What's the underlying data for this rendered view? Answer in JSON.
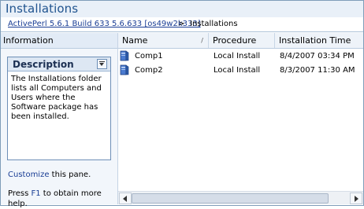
{
  "window": {
    "title": "Installations"
  },
  "breadcrumb": {
    "link": "ActivePerl 5.6.1 Build 633 5.6.633 [os49w2k333]",
    "separator": ">",
    "current": "Installations"
  },
  "left_pane": {
    "header": "Information",
    "description": {
      "title": "Description",
      "text": "The Installations folder lists all Computers and Users where the Software package has been installed."
    },
    "customize_link": "Customize",
    "customize_suffix": " this pane.",
    "help_prefix": "Press ",
    "help_key": "F1",
    "help_suffix": " to obtain more help."
  },
  "list": {
    "columns": [
      "Name",
      "Procedure",
      "Installation Time"
    ],
    "sort_indicator": "/",
    "rows": [
      {
        "name": "Comp1",
        "procedure": "Local Install",
        "time": "8/4/2007 03:34 PM",
        "icon": "computer-icon"
      },
      {
        "name": "Comp2",
        "procedure": "Local Install",
        "time": "8/3/2007 11:30 AM",
        "icon": "computer-icon"
      }
    ]
  },
  "colors": {
    "title_text": "#21548f",
    "link": "#1a3e95",
    "header_bg": "#e9f0f8"
  }
}
